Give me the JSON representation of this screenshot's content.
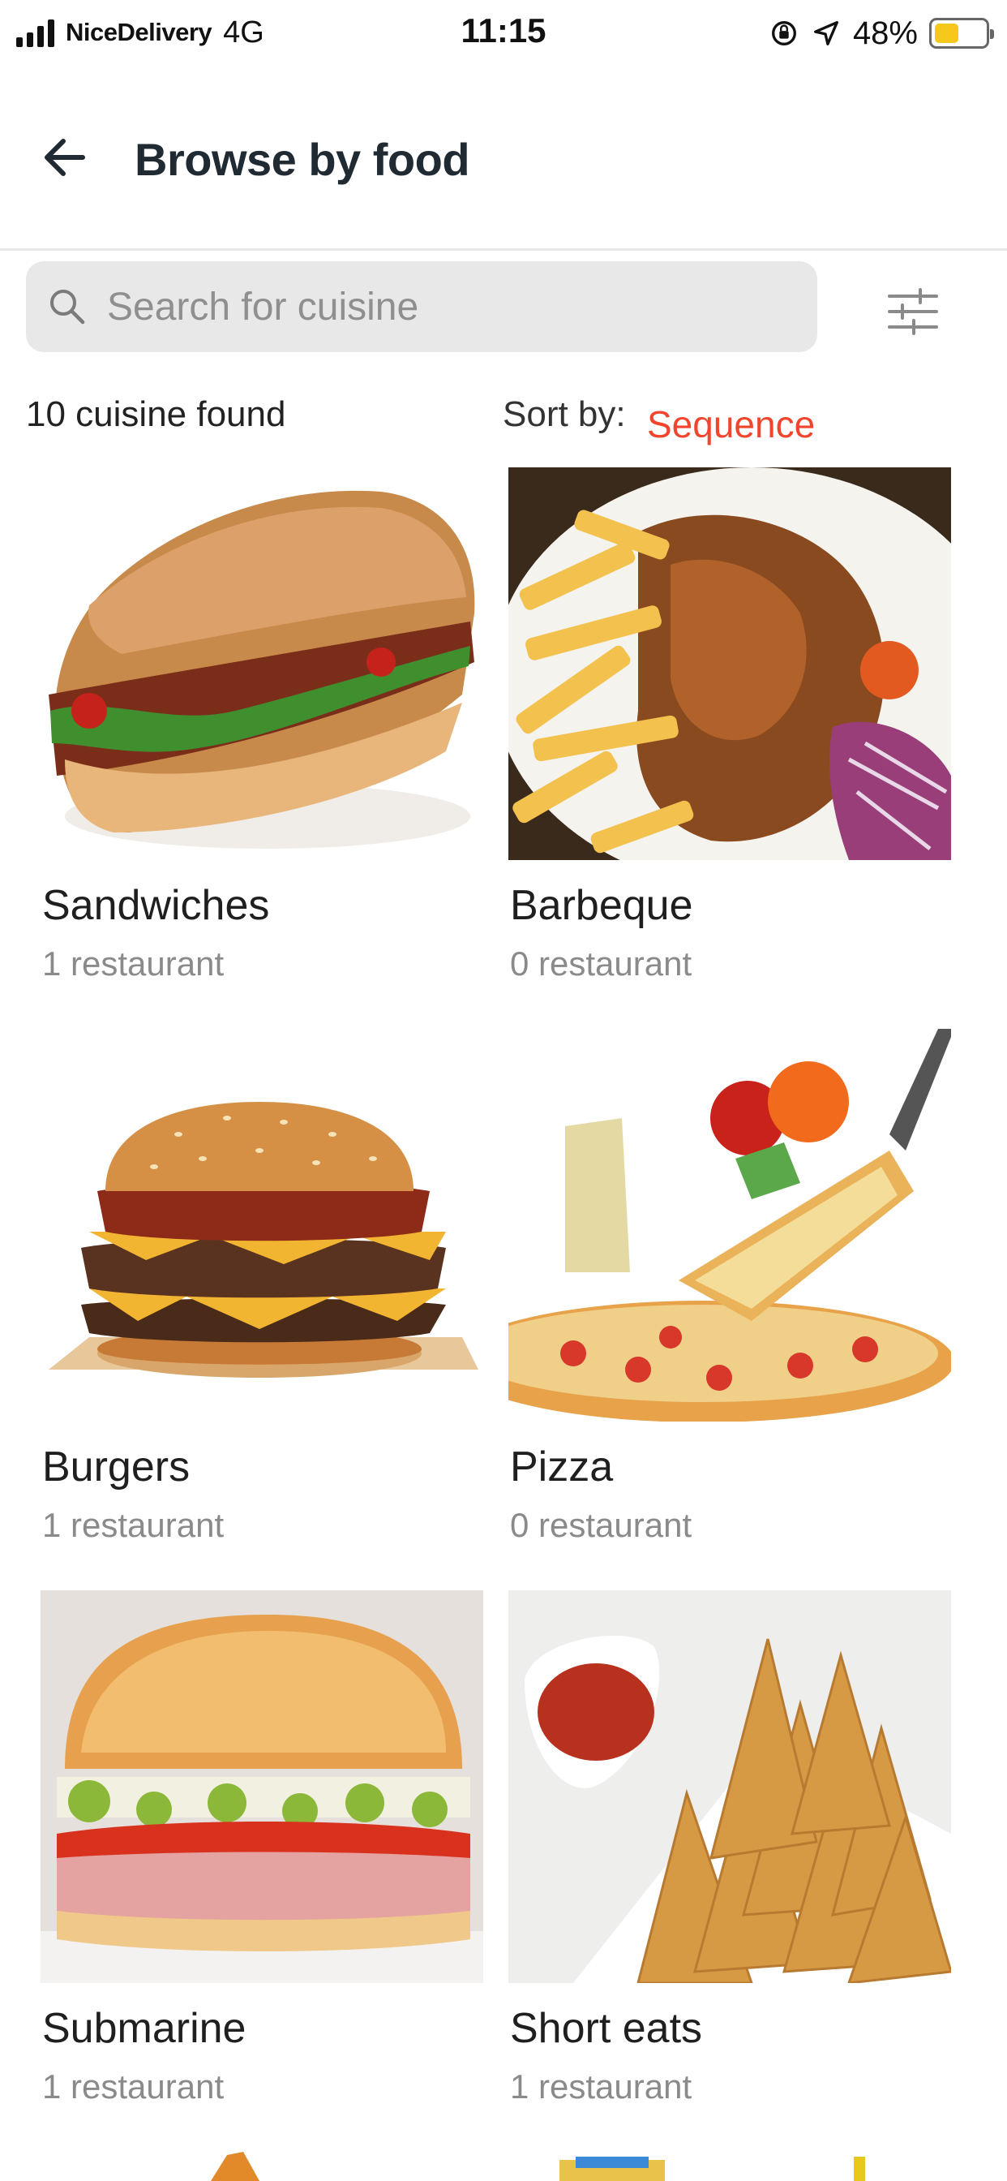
{
  "status_bar": {
    "carrier": "NiceDelivery",
    "network": "4G",
    "time": "11:15",
    "battery_percent": "48%",
    "battery_level": 0.48,
    "battery_color": "#f7c81c",
    "icons": [
      "signal-icon",
      "orientation-lock-icon",
      "location-arrow-icon",
      "battery-icon"
    ]
  },
  "header": {
    "title": "Browse by food",
    "back_icon": "arrow-left-icon"
  },
  "search": {
    "placeholder": "Search for cuisine",
    "icon": "search-icon",
    "filter_icon": "sliders-icon"
  },
  "results": {
    "count_text": "10 cuisine found",
    "sort_label": "Sort by:",
    "sort_value": "Sequence"
  },
  "accent_color": "#f2452e",
  "cuisines": [
    {
      "name": "Sandwiches",
      "count": "1 restaurant",
      "image": "sandwich-photo"
    },
    {
      "name": "Barbeque",
      "count": "0 restaurant",
      "image": "grilled-chicken-fries-photo"
    },
    {
      "name": "Burgers",
      "count": "1 restaurant",
      "image": "burger-photo"
    },
    {
      "name": "Pizza",
      "count": "0 restaurant",
      "image": "pizza-photo"
    },
    {
      "name": "Submarine",
      "count": "1 restaurant",
      "image": "submarine-sandwich-photo"
    },
    {
      "name": "Short eats",
      "count": "1 restaurant",
      "image": "samosa-photo"
    }
  ]
}
